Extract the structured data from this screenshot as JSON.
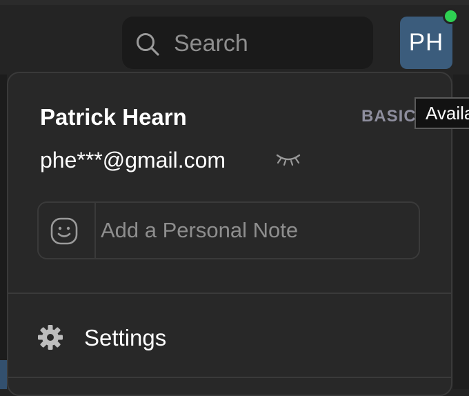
{
  "search": {
    "placeholder": "Search",
    "icon": "search-icon"
  },
  "avatar": {
    "initials": "PH",
    "bg_color": "#3b5c7c",
    "presence_color": "#2ed052"
  },
  "profile": {
    "name": "Patrick Hearn",
    "plan": "BASIC",
    "email": "phe***@gmail.com",
    "email_toggle_icon": "eye-closed-icon"
  },
  "tooltip": {
    "text": "Available"
  },
  "personal_note": {
    "placeholder": "Add a Personal Note",
    "icon": "smiley-icon"
  },
  "menu": {
    "items": [
      {
        "label": "Settings",
        "icon": "gear-icon"
      }
    ]
  }
}
